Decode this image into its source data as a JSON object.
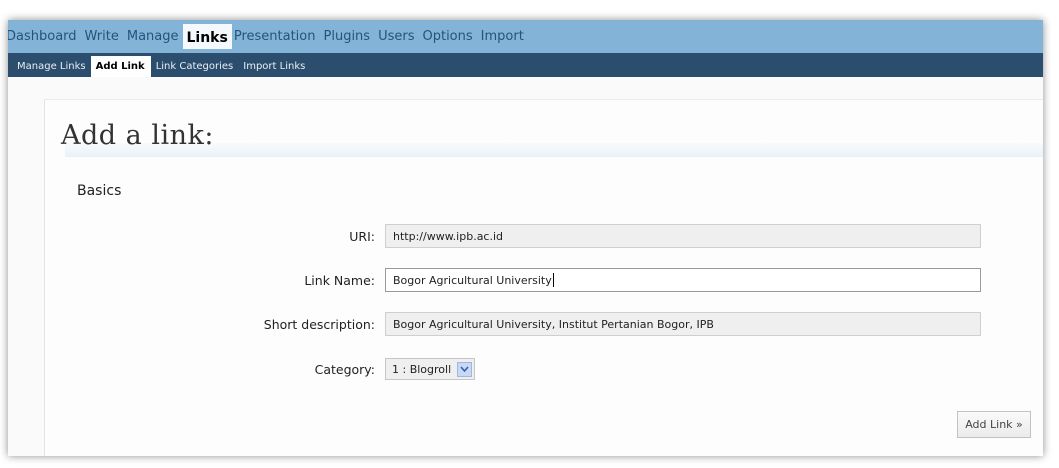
{
  "top_nav": {
    "items": [
      "Dashboard",
      "Write",
      "Manage",
      "Links",
      "Presentation",
      "Plugins",
      "Users",
      "Options",
      "Import"
    ],
    "active": "Links"
  },
  "sub_nav": {
    "items": [
      "Manage Links",
      "Add Link",
      "Link Categories",
      "Import Links"
    ],
    "active": "Add Link"
  },
  "page": {
    "title": "Add a link:",
    "section": "Basics"
  },
  "form": {
    "uri": {
      "label": "URI:",
      "value": "http://www.ipb.ac.id"
    },
    "link_name": {
      "label": "Link Name:",
      "value": "Bogor Agricultural University"
    },
    "short_description": {
      "label": "Short description:",
      "value": "Bogor Agricultural University, Institut Pertanian Bogor, IPB"
    },
    "category": {
      "label": "Category:",
      "value": "1 : Blogroll"
    }
  },
  "actions": {
    "add_link": "Add Link »"
  },
  "colors": {
    "top_nav_bg": "#83b4d8",
    "sub_nav_bg": "#2c4e6e"
  }
}
